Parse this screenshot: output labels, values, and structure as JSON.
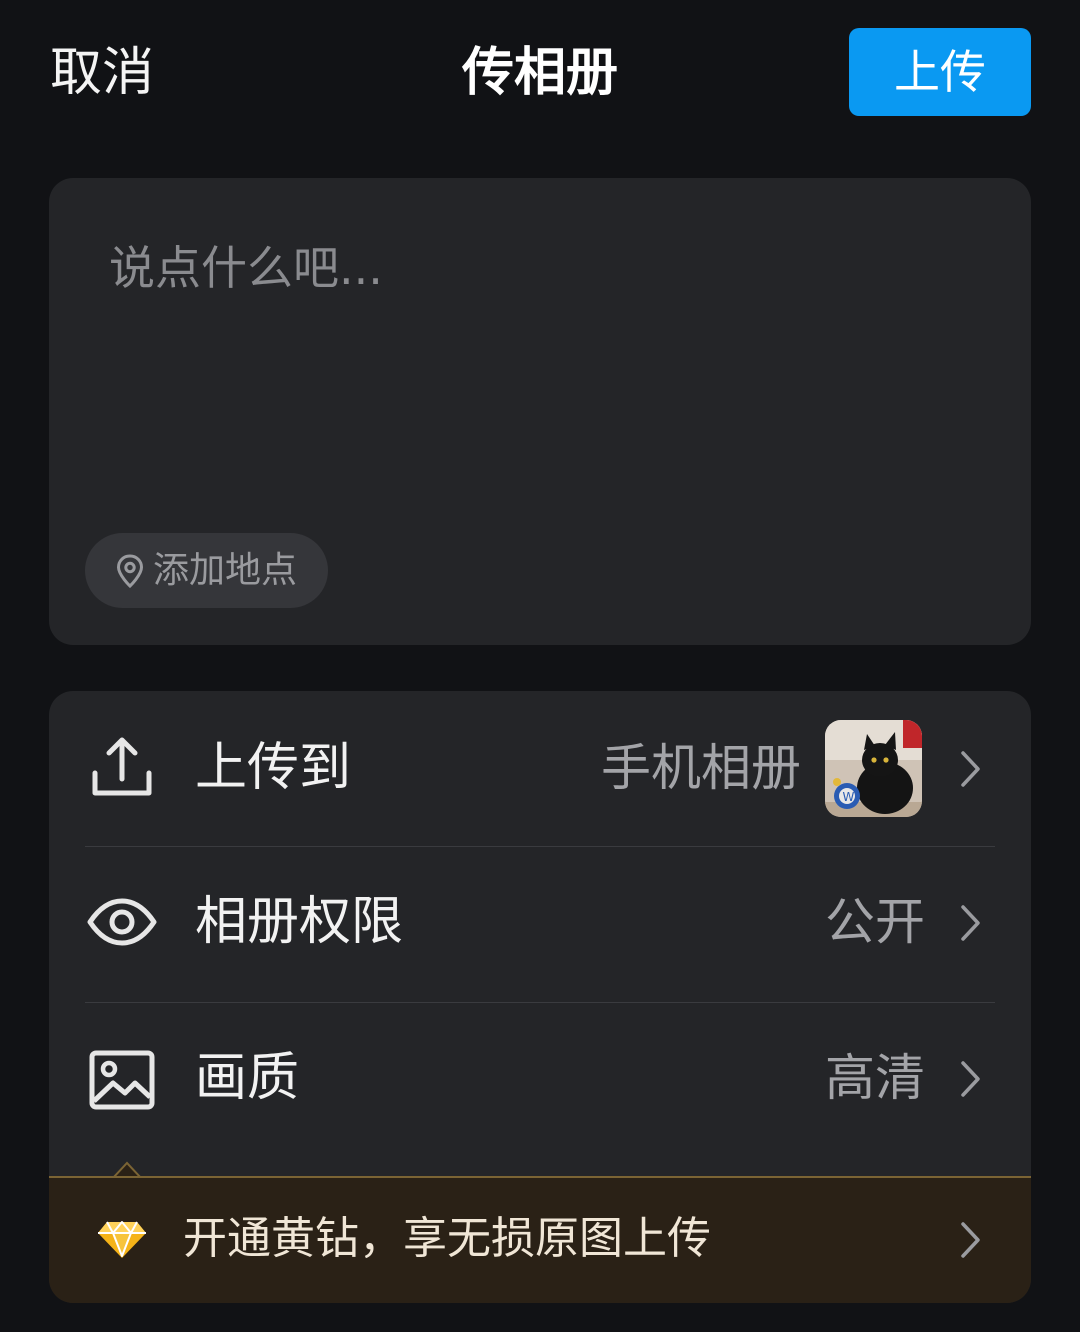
{
  "header": {
    "cancel_label": "取消",
    "title": "传相册",
    "upload_label": "上传",
    "upload_color": "#0a99f2"
  },
  "compose": {
    "placeholder": "说点什么吧...",
    "value": "",
    "location_label": "添加地点",
    "location_icon": "map-pin-icon"
  },
  "settings": {
    "upload_to": {
      "icon": "upload-icon",
      "label": "上传到",
      "value": "手机相册",
      "thumbnail": "cat-photo-thumbnail"
    },
    "permission": {
      "icon": "eye-icon",
      "label": "相册权限",
      "value": "公开"
    },
    "quality": {
      "icon": "image-icon",
      "label": "画质",
      "value": "高清"
    }
  },
  "vip_banner": {
    "icon": "diamond-icon",
    "text": "开通黄钻，享无损原图上传",
    "accent": "#f5b318"
  }
}
